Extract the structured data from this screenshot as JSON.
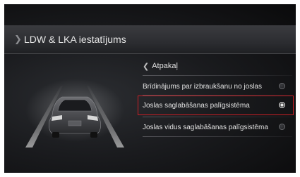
{
  "header": {
    "title": "LDW & LKA iestatījums",
    "chevron_icon": "chevron-right-icon"
  },
  "back": {
    "label": "Atpakaļ",
    "icon": "chevron-left-icon"
  },
  "options": [
    {
      "label": "Brīdinājums par izbraukšanu no joslas",
      "selected": false
    },
    {
      "label": "Joslas saglabāšanas palīgsistēma",
      "selected": true
    },
    {
      "label": "Joslas vidus saglabāšanas palīgsistēma",
      "selected": false
    }
  ],
  "colors": {
    "selection_border": "#cc1f26",
    "background": "#1a1b1e",
    "text": "#e2e2e2"
  }
}
